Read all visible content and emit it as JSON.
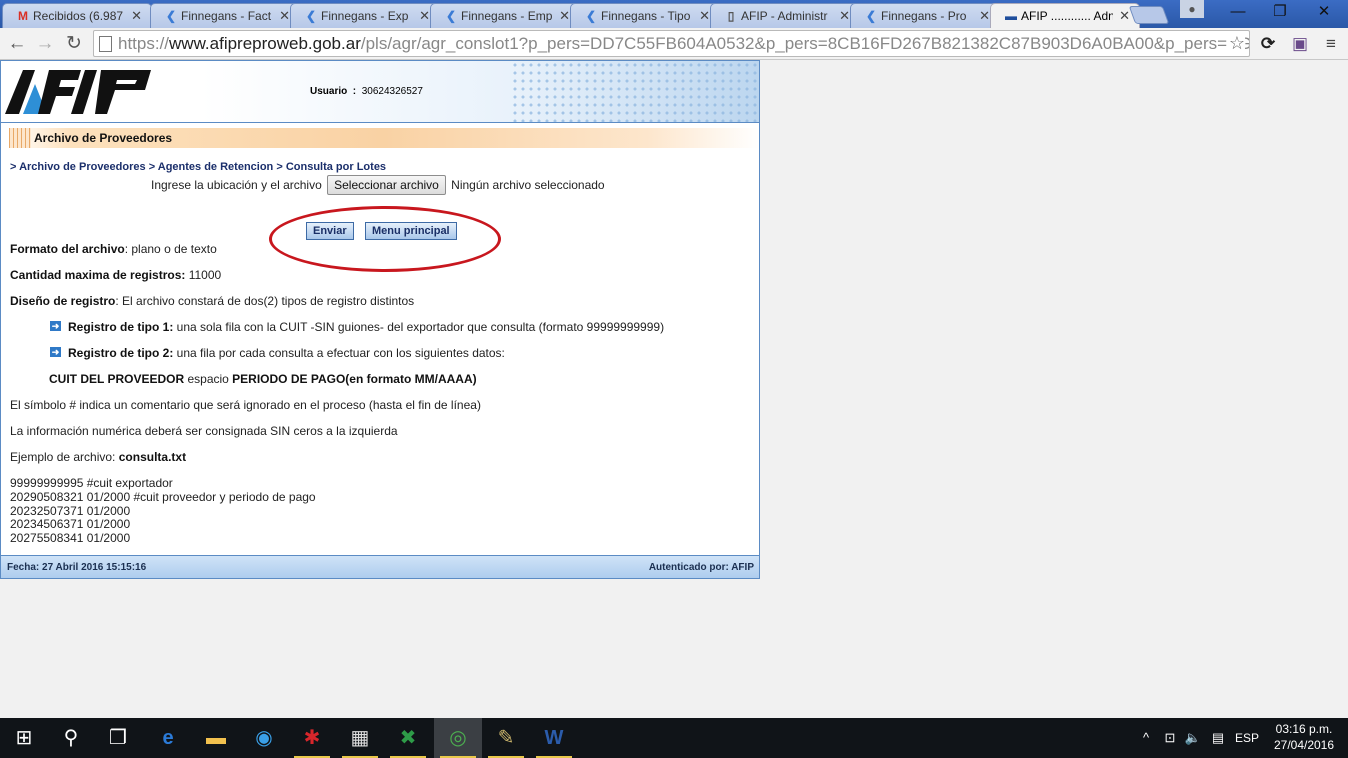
{
  "browser": {
    "tabs": [
      {
        "title": "Recibidos (6.987",
        "icon": "gmail-icon",
        "icon_glyph": "M",
        "icon_color": "#d93025"
      },
      {
        "title": "Finnegans - Fact",
        "icon": "finnegans-icon",
        "icon_glyph": "❮",
        "icon_color": "#3a7bd5"
      },
      {
        "title": "Finnegans - Exp",
        "icon": "finnegans-icon",
        "icon_glyph": "❮",
        "icon_color": "#3a7bd5"
      },
      {
        "title": "Finnegans - Emp",
        "icon": "finnegans-icon",
        "icon_glyph": "❮",
        "icon_color": "#3a7bd5"
      },
      {
        "title": "Finnegans - Tipo",
        "icon": "finnegans-icon",
        "icon_glyph": "❮",
        "icon_color": "#3a7bd5"
      },
      {
        "title": "AFIP - Administr",
        "icon": "document-icon",
        "icon_glyph": "▯",
        "icon_color": "#555555"
      },
      {
        "title": "Finnegans - Pro",
        "icon": "finnegans-icon",
        "icon_glyph": "❮",
        "icon_color": "#3a7bd5"
      },
      {
        "title": "AFIP ............ Adn",
        "icon": "afip-icon",
        "icon_glyph": "▬",
        "icon_color": "#1f4e9c",
        "active": true
      }
    ],
    "url_scheme": "https://",
    "url_host": "www.afipreproweb.gob.ar",
    "url_path": "/pls/agr/agr_conslot1?p_pers=DD7C55FB604A0532&p_pers=8CB16FD267B821382C87B903D6A0BA00&p_pers=AGR_AGERET&"
  },
  "afip": {
    "logo_text": "AFIP",
    "user_label": "Usuario",
    "user_separator": ":",
    "user_value": "30624326527",
    "section_title": "Archivo de Proveedores",
    "breadcrumb": {
      "item1": "> Archivo de Proveedores",
      "item2": "> Agentes de Retencion",
      "item3": "> Consulta por Lotes"
    },
    "file_prompt": "Ingrese la ubicación y el archivo",
    "file_button": "Seleccionar archivo",
    "file_status": "Ningún archivo seleccionado",
    "send_button": "Enviar",
    "menu_button": "Menu principal",
    "format_label": "Formato del archivo",
    "format_value": ": plano o de texto",
    "max_label": "Cantidad maxima de registros:",
    "max_value": " 11000",
    "design_label": "Diseño de registro",
    "design_value": ": El archivo constará de dos(2) tipos de registro distintos",
    "reg1_label": "Registro de tipo 1:",
    "reg1_value": " una sola fila con la CUIT -SIN guiones- del exportador que consulta (formato 99999999999)",
    "reg2_label": "Registro de tipo 2:",
    "reg2_value": " una fila por cada consulta a efectuar con los siguientes datos:",
    "cuit_label": "CUIT DEL PROVEEDOR",
    "cuit_mid": " espacio ",
    "period_label": "PERIODO DE PAGO(en formato MM/AAAA)",
    "comment_note": "El símbolo # indica un comentario que será ignorado en el proceso (hasta el fin de línea)",
    "numeric_note": "La información numérica deberá ser consignada SIN ceros a la izquierda",
    "example_label": "Ejemplo de archivo: ",
    "example_name": "consulta.txt",
    "example_lines": [
      "99999999995 #cuit exportador",
      "20290508321 01/2000 #cuit proveedor y periodo de pago",
      "20232507371 01/2000",
      "20234506371 01/2000",
      "20275508341 01/2000"
    ],
    "footer_date": "Fecha: 27 Abril 2016 15:15:16",
    "footer_auth": "Autenticado por: AFIP"
  },
  "taskbar": {
    "items": [
      "start-icon",
      "search-icon",
      "task-view-icon",
      "edge-icon",
      "file-explorer-icon",
      "app-icon",
      "app-red-icon",
      "calculator-icon",
      "excel-icon",
      "chrome-icon",
      "paint-icon",
      "word-icon"
    ],
    "language": "ESP",
    "time": "03:16 p.m.",
    "date": "27/04/2016"
  },
  "colors": {
    "afip_blue": "#1b2f6b",
    "highlight_red": "#c8171e",
    "section_orange": "#f9d2a4"
  }
}
